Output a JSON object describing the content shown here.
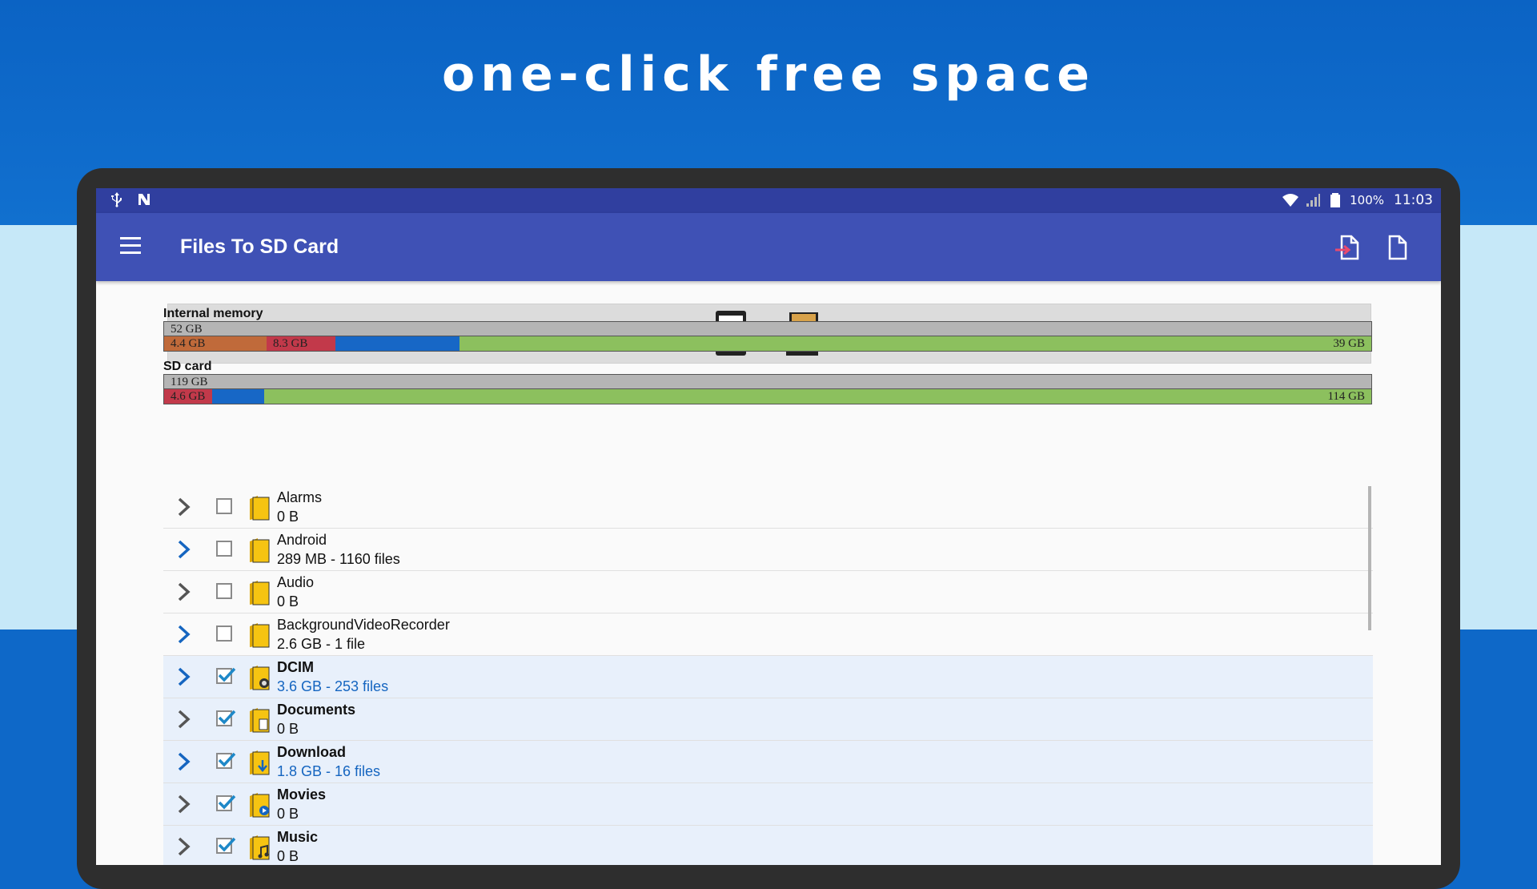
{
  "promo": {
    "title": "one-click free space"
  },
  "status": {
    "battery": "100%",
    "time": "11:03"
  },
  "app": {
    "title": "Files To SD Card",
    "menu_icon": "hamburger-menu-icon",
    "action_move_icon": "file-move-icon",
    "action_file_icon": "file-icon"
  },
  "storage": {
    "internal": {
      "label": "Internal memory",
      "total": "52 GB",
      "segments": [
        {
          "label": "4.4 GB",
          "color": "#c06a3a"
        },
        {
          "label": "8.3 GB",
          "color": "#c2394a"
        },
        {
          "label": "",
          "color": "#1767c6"
        },
        {
          "label": "39 GB",
          "color": "#8cc05e"
        }
      ],
      "fractions": [
        0.085,
        0.057,
        0.103,
        0.755
      ]
    },
    "sd": {
      "label": "SD card",
      "total": "119 GB",
      "segments": [
        {
          "label": "4.6 GB",
          "color": "#c2394a"
        },
        {
          "label": "",
          "color": "#1767c6"
        },
        {
          "label": "114 GB",
          "color": "#8cc05e"
        }
      ],
      "fractions": [
        0.04,
        0.043,
        0.917
      ]
    }
  },
  "folders": [
    {
      "name": "Alarms",
      "size": "0 B",
      "checked": false,
      "chevron_color": "#555555"
    },
    {
      "name": "Android",
      "size": "289 MB - 1160 files",
      "checked": false,
      "chevron_color": "#1565c0"
    },
    {
      "name": "Audio",
      "size": "0 B",
      "checked": false,
      "chevron_color": "#555555"
    },
    {
      "name": "BackgroundVideoRecorder",
      "size": "2.6 GB - 1 file",
      "checked": false,
      "chevron_color": "#1565c0"
    },
    {
      "name": "DCIM",
      "size": "3.6 GB - 253 files",
      "checked": true,
      "chevron_color": "#1565c0"
    },
    {
      "name": "Documents",
      "size": "0 B",
      "checked": true,
      "chevron_color": "#555555"
    },
    {
      "name": "Download",
      "size": "1.8 GB - 16 files",
      "checked": true,
      "chevron_color": "#1565c0"
    },
    {
      "name": "Movies",
      "size": "0 B",
      "checked": true,
      "chevron_color": "#555555"
    },
    {
      "name": "Music",
      "size": "0 B",
      "checked": true,
      "chevron_color": "#555555"
    }
  ],
  "colors": {
    "appbar": "#3f51b5",
    "statusbar": "#303f9f",
    "accent_blue": "#1565c0",
    "folder_yellow": "#f6c412"
  }
}
